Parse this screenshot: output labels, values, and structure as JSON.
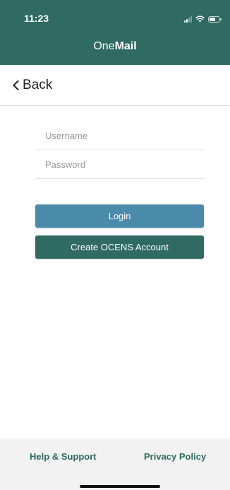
{
  "status_bar": {
    "time": "11:23",
    "icons": [
      "signal-icon",
      "wifi-icon",
      "battery-icon"
    ]
  },
  "header": {
    "title_regular": "One",
    "title_bold": "Mail"
  },
  "nav": {
    "back_label": "Back",
    "back_icon": "chevron-left-icon"
  },
  "form": {
    "username_placeholder": "Username",
    "username_value": "",
    "password_placeholder": "Password",
    "password_value": ""
  },
  "actions": {
    "login_label": "Login",
    "create_account_label": "Create OCENS Account"
  },
  "footer": {
    "help_label": "Help & Support",
    "privacy_label": "Privacy Policy"
  },
  "colors": {
    "brand_teal": "#2f6b62",
    "login_blue": "#4a8bab",
    "footer_bg": "#f2f2f2"
  }
}
